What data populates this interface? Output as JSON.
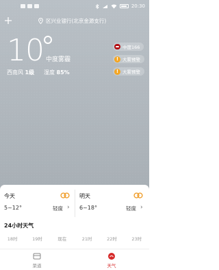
{
  "status_bar": {
    "time": "20:30"
  },
  "location": {
    "name": "区兴业银行(北京金源支行)"
  },
  "current": {
    "temperature": "10",
    "condition": "中度雾霾",
    "wind_label": "西南风",
    "wind_level": "1级",
    "humidity_label": "湿度",
    "humidity_value": "85%"
  },
  "badges": {
    "aqi": "中度166",
    "warning_1": "大雾预警",
    "warning_2": "大雾预警"
  },
  "forecast": [
    {
      "day": "今天",
      "range": "5~12°",
      "air": "轻度"
    },
    {
      "day": "明天",
      "range": "6~18°",
      "air": "轻度"
    }
  ],
  "hourly": {
    "title": "24小时天气",
    "hours": [
      "18时",
      "19时",
      "现在",
      "21时",
      "22时",
      "23时"
    ]
  },
  "tabs": [
    {
      "label": "菜道"
    },
    {
      "label": "天气"
    }
  ],
  "colors": {
    "accent_red": "#d62b2b",
    "warning_orange": "#f4a623",
    "sun_orange": "#f0a030"
  }
}
